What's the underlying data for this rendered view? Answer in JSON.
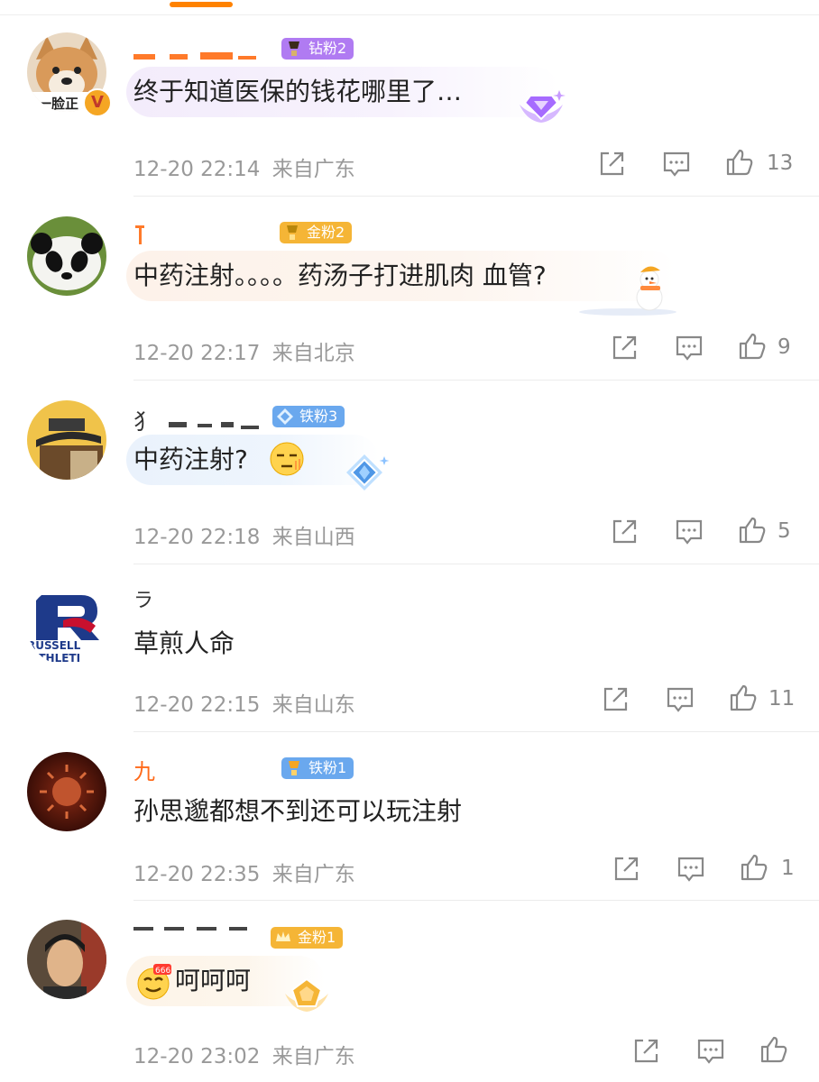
{
  "comments": [
    {
      "name_fragment": "",
      "avatar": "shiba-dog-avatar",
      "avatar_caption": "一脸正",
      "verified_badge": "V",
      "fan_badge": {
        "label": "钻粉2",
        "color": "#b07bf2",
        "icon": "diamond-trophy-icon"
      },
      "text": "终于知道医保的钱花哪里了…",
      "decoration": "purple-diamond-badge",
      "date": "12-20 22:14",
      "location": "来自广东",
      "likes": "13"
    },
    {
      "name_fragment": "",
      "avatar": "panda-avatar",
      "fan_badge": {
        "label": "金粉2",
        "color": "#f5b536",
        "icon": "gold-trophy-icon"
      },
      "text": "中药注射。。。。药汤子打进肌肉 血管?",
      "decoration": "snowman-sticker",
      "date": "12-20 22:17",
      "location": "来自北京",
      "likes": "9"
    },
    {
      "name_fragment": "犭",
      "avatar": "palace-roof-avatar",
      "fan_badge": {
        "label": "铁粉3",
        "color": "#6aa8ee",
        "icon": "blue-diamond-icon"
      },
      "text": "中药注射?",
      "decoration": "blue-diamond-badge",
      "date": "12-20 22:18",
      "location": "来自山西",
      "likes": "5"
    },
    {
      "name_fragment": "ラ",
      "avatar": "russell-athletic-avatar",
      "avatar_lines": [
        "RUSSELL",
        "ATHLETI"
      ],
      "text": "草煎人命",
      "date": "12-20 22:15",
      "location": "来自山东",
      "likes": "11"
    },
    {
      "name_fragment": "九",
      "avatar": "virus-avatar",
      "fan_badge": {
        "label": "铁粉1",
        "color": "#6aa8ee",
        "icon": "trophy-icon"
      },
      "text": "孙思邈都想不到还可以玩注射",
      "date": "12-20 22:35",
      "location": "来自广东",
      "likes": "1"
    },
    {
      "name_fragment": "",
      "avatar": "man-photo-avatar",
      "fan_badge": {
        "label": "金粉1",
        "color": "#f5b536",
        "icon": "gold-crown-icon"
      },
      "emoji": "666",
      "text": "呵呵呵",
      "decoration": "gold-pentagon-badge",
      "date": "12-20 23:02",
      "location": "来自广东",
      "likes": ""
    }
  ],
  "colors": {
    "accent": "#ff8200",
    "meta": "#999999",
    "text": "#222222"
  }
}
